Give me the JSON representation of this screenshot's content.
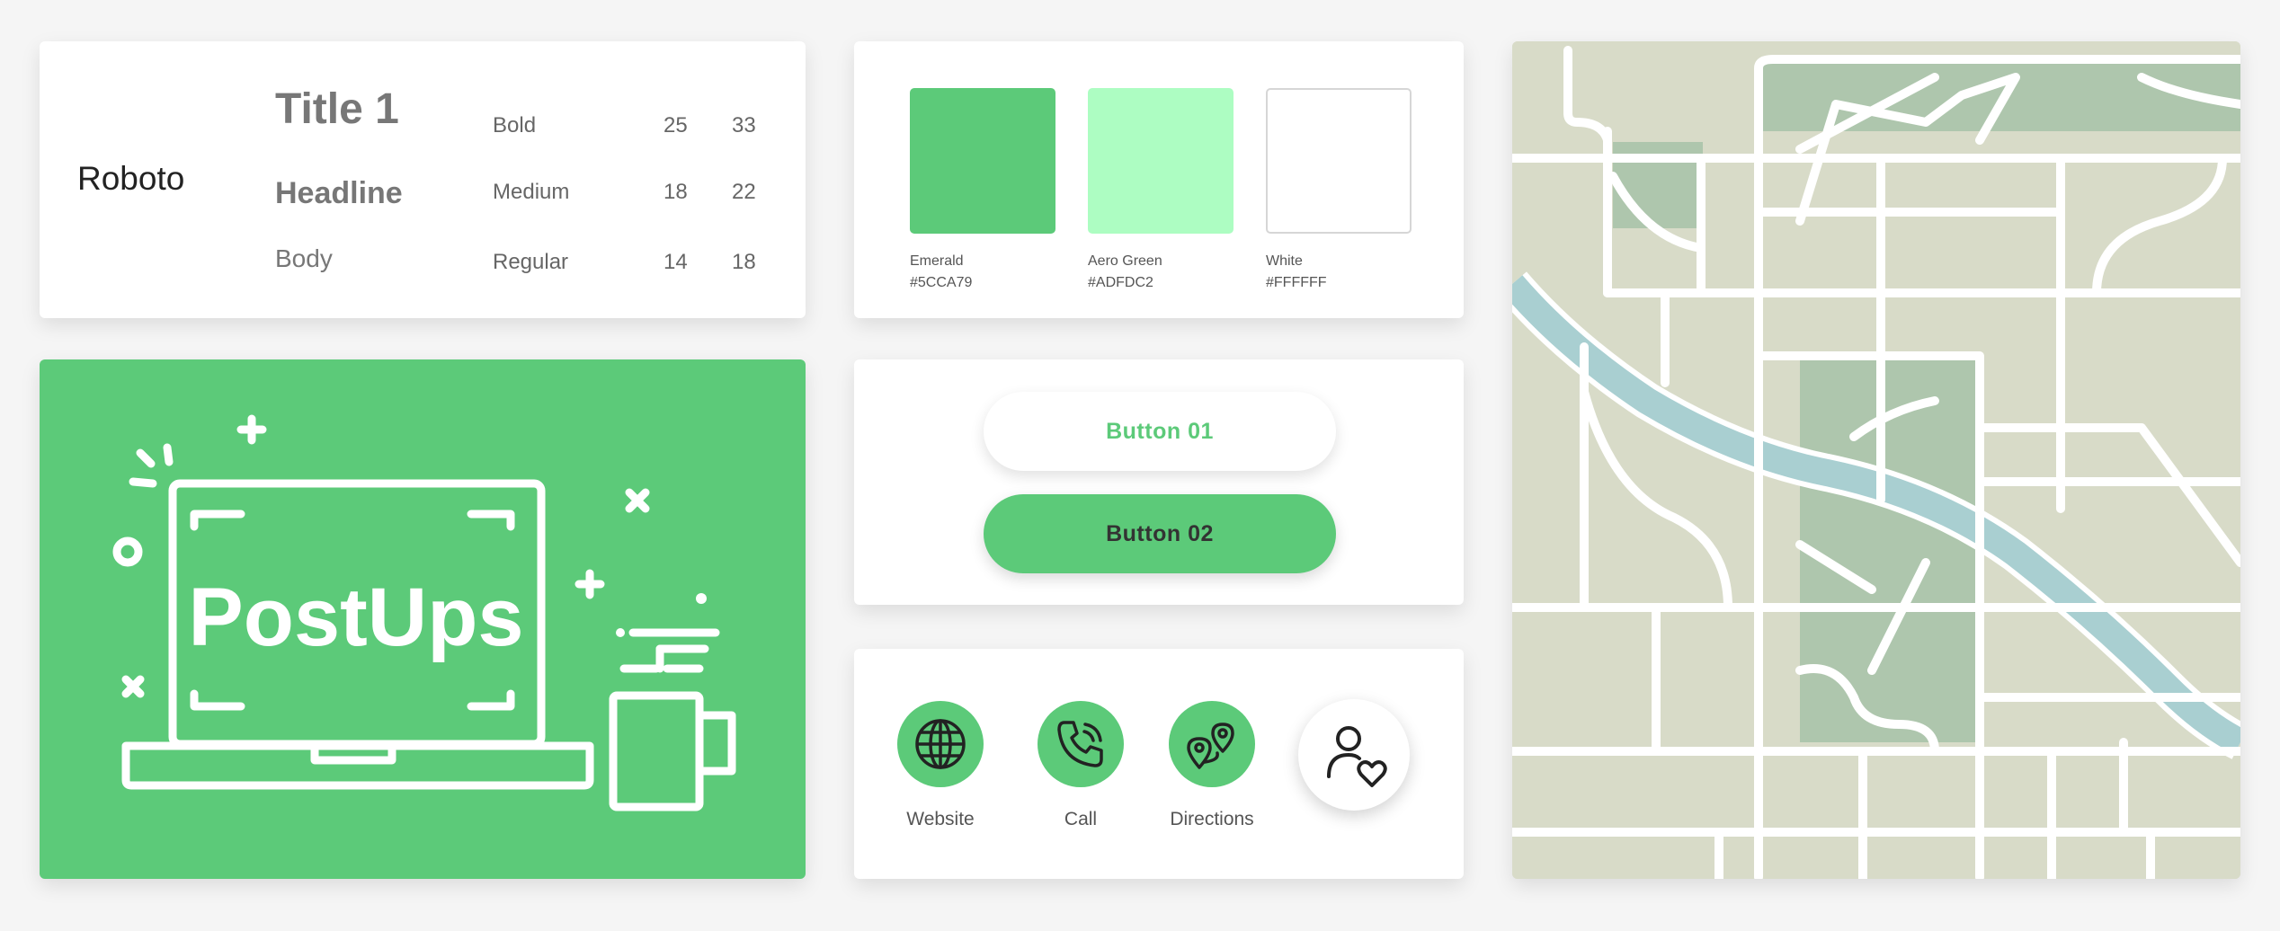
{
  "typography": {
    "font_name": "Roboto",
    "rows": [
      {
        "style": "Title 1",
        "weight": "Bold",
        "size": "25",
        "line_height": "33"
      },
      {
        "style": "Headline",
        "weight": "Medium",
        "size": "18",
        "line_height": "22"
      },
      {
        "style": "Body",
        "weight": "Regular",
        "size": "14",
        "line_height": "18"
      }
    ]
  },
  "palette": [
    {
      "name": "Emerald",
      "hex": "#5CCA79",
      "color": "#5cca79"
    },
    {
      "name": "Aero Green",
      "hex": "#ADFDC2",
      "color": "#adfdc2"
    },
    {
      "name": "White",
      "hex": "#FFFFFF",
      "color": "#ffffff"
    }
  ],
  "brand": {
    "logo_text": "PostUps",
    "color": "#5cca79"
  },
  "buttons": {
    "button_01": "Button 01",
    "button_02": "Button 02"
  },
  "actions": {
    "website": "Website",
    "call": "Call",
    "directions": "Directions"
  },
  "colors": {
    "accent": "#5cca79",
    "map_land": "#d8dbc8",
    "map_park": "#aec6ad",
    "map_river": "#a9cfd1"
  }
}
